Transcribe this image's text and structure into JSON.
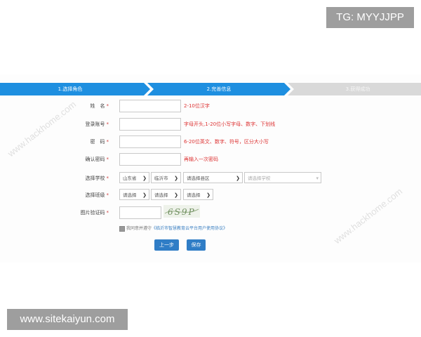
{
  "overlay": {
    "tg": "TG: MYYJJPP",
    "site": "www.sitekaiyun.com"
  },
  "watermark": "www.hackhome.com",
  "steps": [
    {
      "label": "1.选择角色",
      "state": "done"
    },
    {
      "label": "2.完善信息",
      "state": "active"
    },
    {
      "label": "3.获得成功",
      "state": "pending"
    }
  ],
  "colors": {
    "step_active": "#1e8fe0",
    "step_pending": "#d9d9d9",
    "button": "#2f7dc6",
    "hint": "#dd3333"
  },
  "form": {
    "name": {
      "label": "姓　名",
      "required": "*",
      "hint": "2-10位汉字"
    },
    "account": {
      "label": "登录账号",
      "required": "*",
      "hint": "字母开头,1-20位小写字母、数字、下划线"
    },
    "password": {
      "label": "密　码",
      "required": "*",
      "hint": "6-20位英文、数字、符号，区分大小写"
    },
    "confirm": {
      "label": "确认密码",
      "required": "*",
      "hint": "再输入一次密码"
    },
    "school": {
      "label": "选择学校",
      "required": "*",
      "province": "山东省",
      "city": "临沂市",
      "district": "请选择县区",
      "school": "请选择学校"
    },
    "class": {
      "label": "选择班级",
      "required": "*",
      "grade": "请选择",
      "class": "请选择",
      "sub": "请选择"
    },
    "captcha": {
      "label": "图片验证码",
      "required": "*",
      "image_text": "6S9P"
    },
    "agree": {
      "text": "我同意并遵守",
      "link": "《临沂市智慧教育云平台用户使用协议》"
    }
  },
  "buttons": {
    "prev": "上一步",
    "save": "保存"
  }
}
